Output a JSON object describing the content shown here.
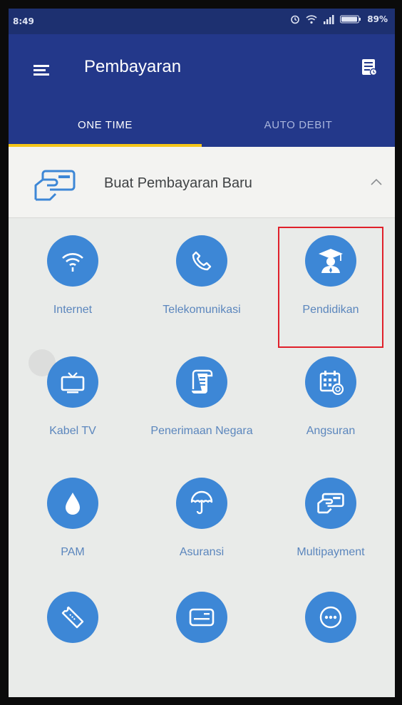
{
  "status_bar": {
    "time": "8:49",
    "battery": "89%"
  },
  "appbar": {
    "title": "Pembayaran",
    "menu_icon": "hamburger-menu-icon",
    "history_icon": "receipt-history-icon"
  },
  "tabs": [
    {
      "label": "ONE TIME",
      "active": true
    },
    {
      "label": "AUTO DEBIT",
      "active": false
    }
  ],
  "new_payment": {
    "label": "Buat Pembayaran Baru",
    "icon": "card-hand-icon",
    "expanded": true
  },
  "menu": [
    {
      "label": "Internet",
      "icon": "wifi-icon"
    },
    {
      "label": "Telekomunikasi",
      "icon": "phone-icon"
    },
    {
      "label": "Pendidikan",
      "icon": "graduation-icon",
      "highlighted": true
    },
    {
      "label": "Kabel TV",
      "icon": "tv-icon"
    },
    {
      "label": "Penerimaan Negara",
      "icon": "scroll-icon"
    },
    {
      "label": "Angsuran",
      "icon": "calendar-icon"
    },
    {
      "label": "PAM",
      "icon": "water-drop-icon"
    },
    {
      "label": "Asuransi",
      "icon": "umbrella-icon"
    },
    {
      "label": "Multipayment",
      "icon": "card-hand-icon"
    },
    {
      "label": "",
      "icon": "ticket-icon"
    },
    {
      "label": "",
      "icon": "credit-card-icon"
    },
    {
      "label": "",
      "icon": "more-icon"
    }
  ],
  "colors": {
    "primary": "#23388a",
    "accent": "#f5c518",
    "icon_bg": "#3d87d6",
    "highlight": "#e0202a"
  }
}
